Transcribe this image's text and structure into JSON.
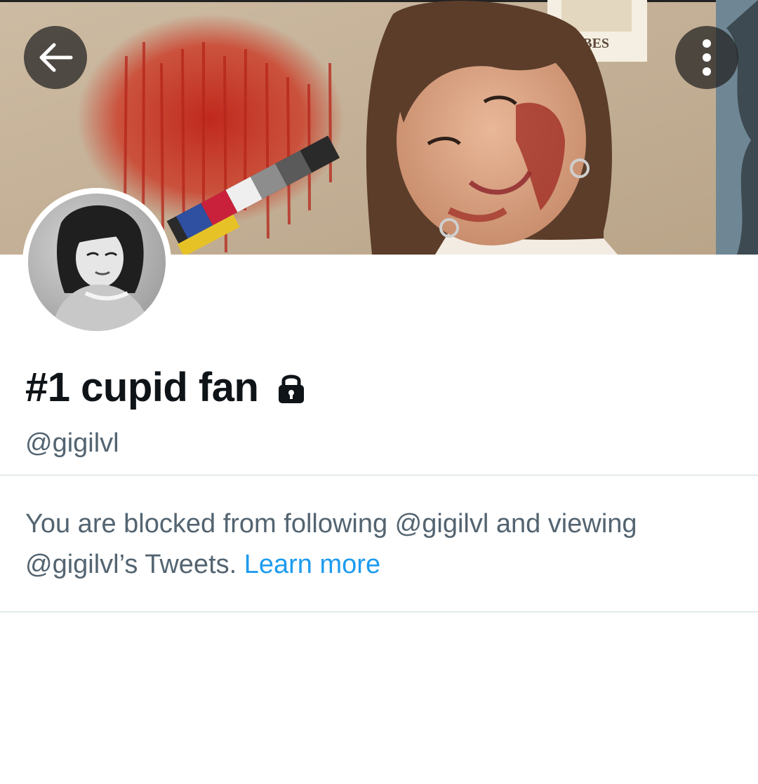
{
  "header": {
    "back_icon": "arrow-left-icon",
    "more_icon": "more-vertical-icon",
    "banner_sign_text": "VIBES"
  },
  "profile": {
    "display_name": "#1 cupid fan",
    "protected_icon": "lock-icon",
    "handle": "@gigilvl"
  },
  "blocked_notice": {
    "text": "You are blocked from following @gigilvl and viewing @gigilvl’s Tweets. ",
    "link_label": "Learn more"
  },
  "colors": {
    "primary_text": "#0f1419",
    "secondary_text": "#536471",
    "link": "#1d9bf0",
    "divider": "#cfd9de"
  }
}
